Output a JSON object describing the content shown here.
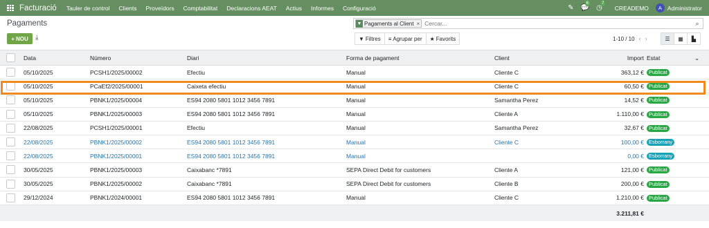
{
  "topbar": {
    "app_title": "Facturació",
    "menu": [
      "Tauler de control",
      "Clients",
      "Proveïdors",
      "Comptabilitat",
      "Declaracions AEAT",
      "Actius",
      "Informes",
      "Configuració"
    ],
    "messages_count": "6",
    "activities_count": "7",
    "company": "CREADEMO",
    "user_initial": "A",
    "user_name": "Administrator"
  },
  "breadcrumb": "Pagaments",
  "toolbar": {
    "new_label": "NOU"
  },
  "search": {
    "facet_label": "Pagaments al Client",
    "placeholder": "Cercar..."
  },
  "filters": {
    "filters_label": "Filtres",
    "group_label": "Agrupar per",
    "favorites_label": "Favorits"
  },
  "pager": {
    "text": "1-10 / 10"
  },
  "table": {
    "headers": {
      "date": "Data",
      "number": "Número",
      "journal": "Diari",
      "method": "Forma de pagament",
      "client": "Client",
      "amount": "Import",
      "status": "Estat"
    },
    "rows": [
      {
        "date": "05/10/2025",
        "number": "PCSH1/2025/00002",
        "journal": "Efectiu",
        "method": "Manual",
        "client": "Cliente C",
        "amount": "363,12 €",
        "status": "Publicat",
        "state": "posted"
      },
      {
        "date": "05/10/2025",
        "number": "PCaEf2/2025/00001",
        "journal": "Caixeta efectiu",
        "method": "Manual",
        "client": "Cliente C",
        "amount": "60,50 €",
        "status": "Publicat",
        "state": "posted"
      },
      {
        "date": "05/10/2025",
        "number": "PBNK1/2025/00004",
        "journal": "ES94 2080 5801 1012 3456 7891",
        "method": "Manual",
        "client": "Samantha Perez",
        "amount": "14,52 €",
        "status": "Publicat",
        "state": "posted"
      },
      {
        "date": "05/10/2025",
        "number": "PBNK1/2025/00003",
        "journal": "ES94 2080 5801 1012 3456 7891",
        "method": "Manual",
        "client": "Cliente A",
        "amount": "1.110,00 €",
        "status": "Publicat",
        "state": "posted"
      },
      {
        "date": "22/08/2025",
        "number": "PCSH1/2025/00001",
        "journal": "Efectiu",
        "method": "Manual",
        "client": "Samantha Perez",
        "amount": "32,67 €",
        "status": "Publicat",
        "state": "posted"
      },
      {
        "date": "22/08/2025",
        "number": "PBNK1/2025/00002",
        "journal": "ES94 2080 5801 1012 3456 7891",
        "method": "Manual",
        "client": "Cliente C",
        "amount": "100,00 €",
        "status": "Esborrany",
        "state": "draft"
      },
      {
        "date": "22/08/2025",
        "number": "PBNK1/2025/00001",
        "journal": "ES94 2080 5801 1012 3456 7891",
        "method": "Manual",
        "client": "",
        "amount": "0,00 €",
        "status": "Esborrany",
        "state": "draft"
      },
      {
        "date": "30/05/2025",
        "number": "PBNK1/2025/00003",
        "journal": "Caixabanc *7891",
        "method": "SEPA Direct Debit for customers",
        "client": "Cliente A",
        "amount": "121,00 €",
        "status": "Publicat",
        "state": "posted"
      },
      {
        "date": "30/05/2025",
        "number": "PBNK1/2025/00002",
        "journal": "Caixabanc *7891",
        "method": "SEPA Direct Debit for customers",
        "client": "Cliente B",
        "amount": "200,00 €",
        "status": "Publicat",
        "state": "posted"
      },
      {
        "date": "29/12/2024",
        "number": "PBNK1/2024/00001",
        "journal": "ES94 2080 5801 1012 3456 7891",
        "method": "Manual",
        "client": "Cliente C",
        "amount": "1.210,00 €",
        "status": "Publicat",
        "state": "posted"
      }
    ],
    "total": "3.211,81 €"
  },
  "colors": {
    "topbar": "#658f61",
    "posted": "#28a745",
    "draft": "#17a2b8",
    "highlight": "#ef8a1f"
  }
}
